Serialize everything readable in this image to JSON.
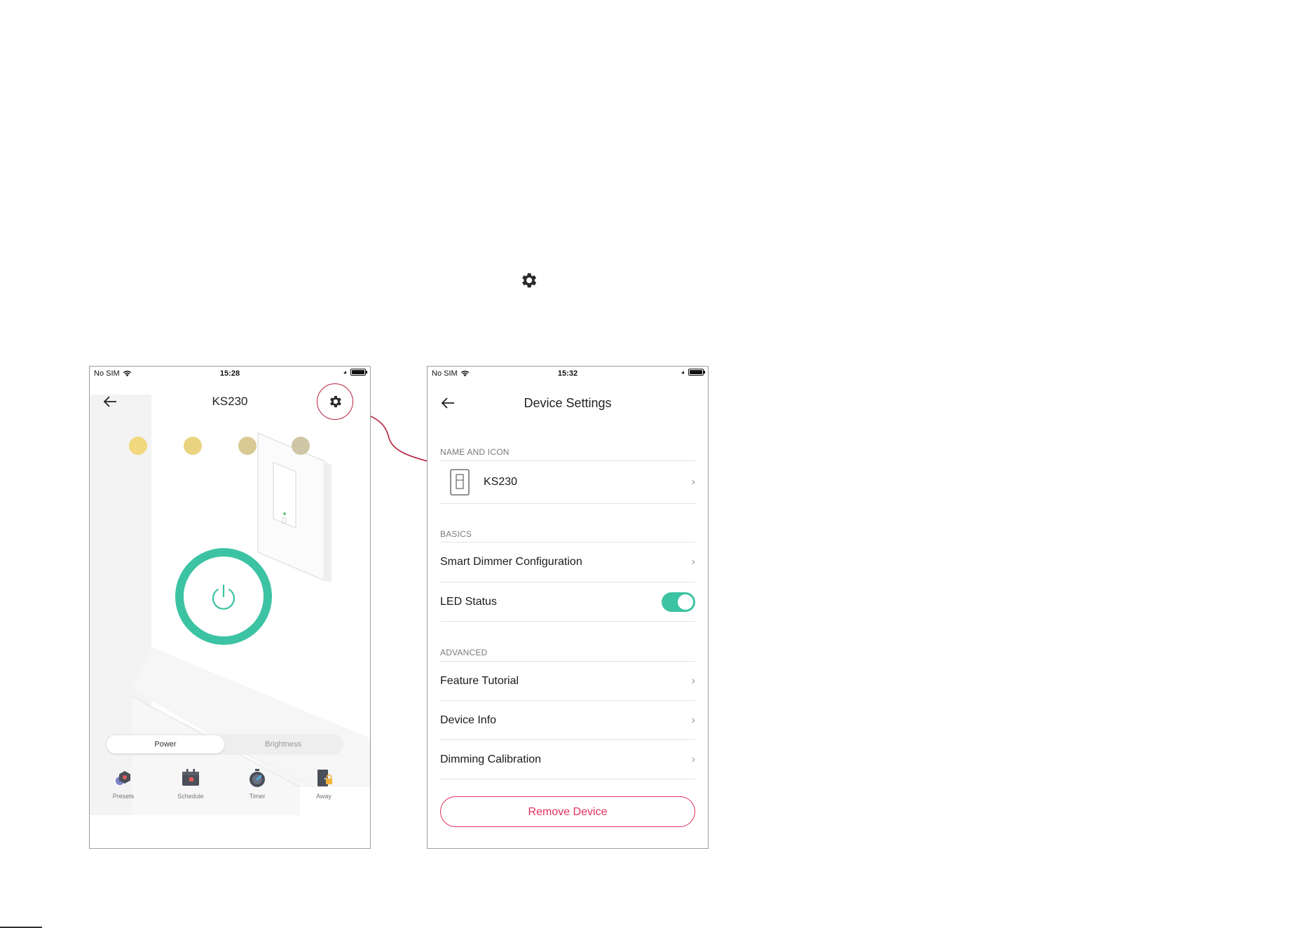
{
  "left_phone": {
    "status": {
      "carrier": "No SIM",
      "time": "15:28"
    },
    "title": "KS230",
    "brightness_dot_colors": [
      "#f1d77d",
      "#ead37f",
      "#d8c995",
      "#cfc6a5"
    ],
    "segment": {
      "power": "Power",
      "brightness": "Brightness"
    },
    "bottom_nav": [
      {
        "label": "Presets",
        "icon": "presets-icon"
      },
      {
        "label": "Schedule",
        "icon": "schedule-icon"
      },
      {
        "label": "Timer",
        "icon": "timer-icon"
      },
      {
        "label": "Away",
        "icon": "away-icon"
      }
    ],
    "accent_color": "#3cc3a3"
  },
  "right_phone": {
    "status": {
      "carrier": "No SIM",
      "time": "15:32"
    },
    "title": "Device Settings",
    "sections": {
      "name_and_icon": "NAME AND ICON",
      "basics": "BASICS",
      "advanced": "ADVANCED"
    },
    "device_name": "KS230",
    "rows": {
      "smart_dimmer": "Smart Dimmer Configuration",
      "led_status": "LED Status",
      "feature_tutorial": "Feature Tutorial",
      "device_info": "Device Info",
      "dimming_calibration": "Dimming Calibration"
    },
    "led_status_on": true,
    "remove_button": "Remove Device",
    "danger_color": "#e2305c"
  },
  "callout_color": "#b5213c"
}
